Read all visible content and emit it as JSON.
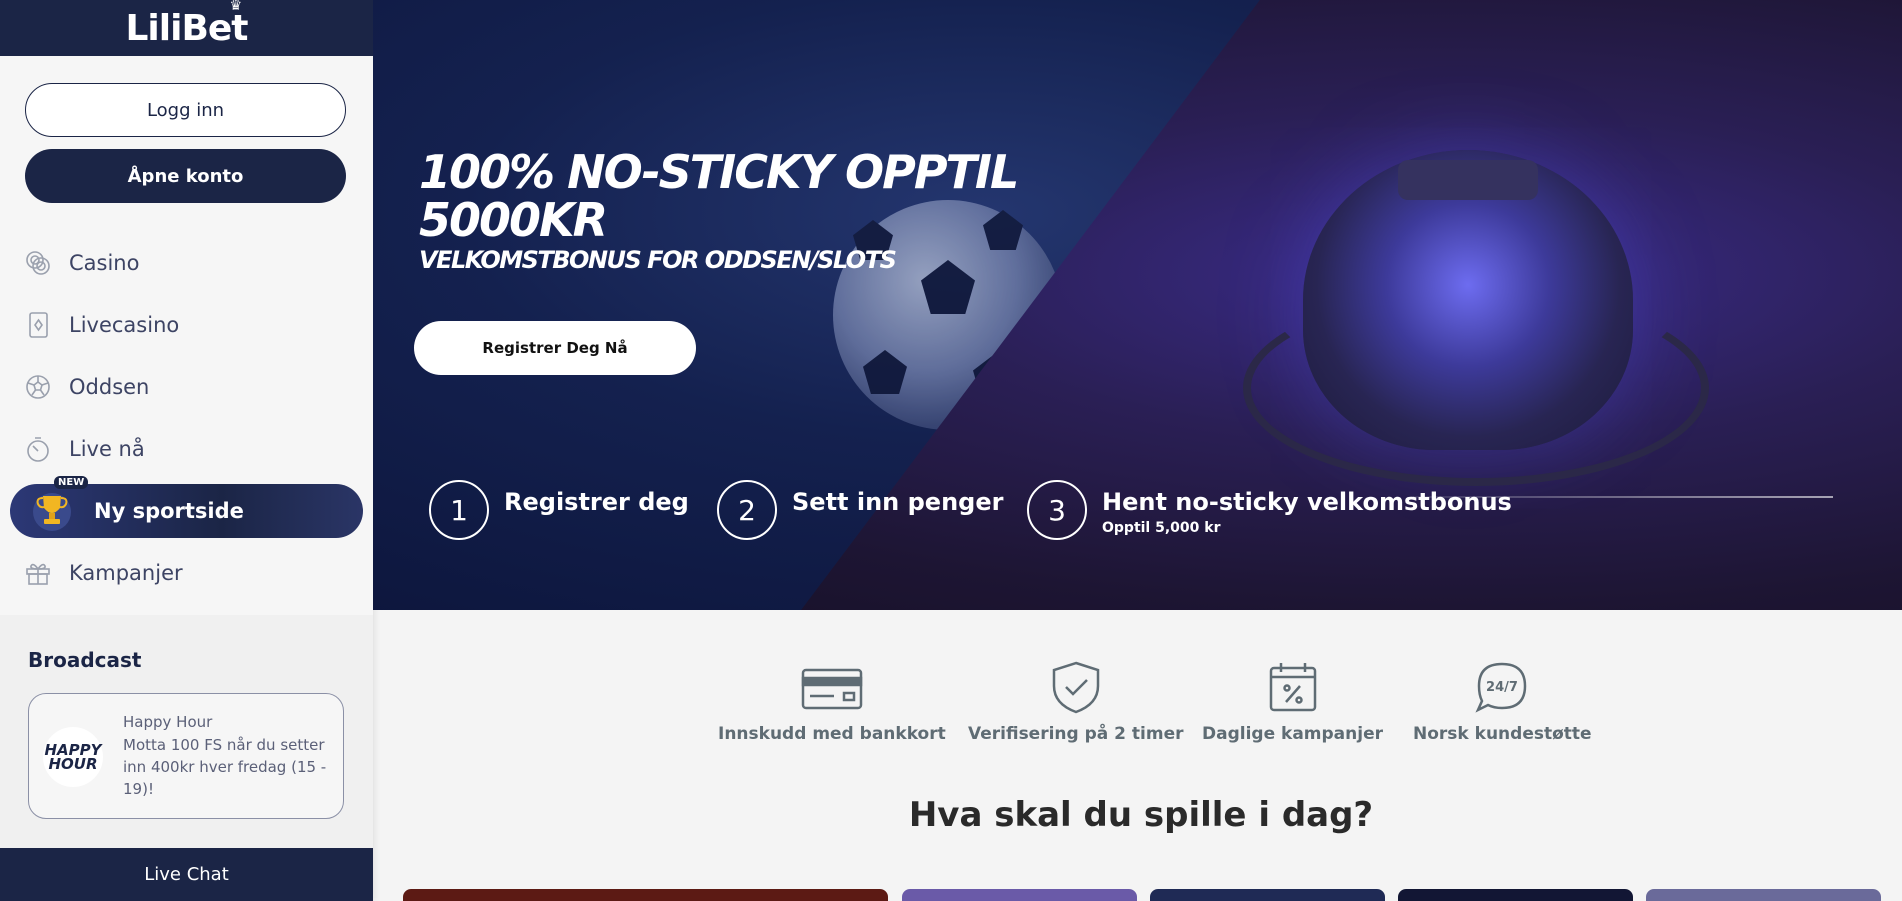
{
  "sidebar": {
    "logo": "LiliBet",
    "login_button": "Logg inn",
    "open_account_button": "Åpne konto",
    "nav": [
      {
        "label": "Casino",
        "icon": "chips-icon"
      },
      {
        "label": "Livecasino",
        "icon": "card-icon"
      },
      {
        "label": "Oddsen",
        "icon": "football-icon"
      },
      {
        "label": "Live nå",
        "icon": "stopwatch-icon"
      }
    ],
    "new_item": {
      "label": "Ny sportside",
      "badge": "NEW",
      "icon": "trophy-icon"
    },
    "campaigns": {
      "label": "Kampanjer",
      "icon": "gift-icon"
    },
    "broadcast": {
      "title": "Broadcast",
      "card_logo": "HAPPY HOUR",
      "card_title": "Happy Hour",
      "card_text": "Motta 100 FS når du setter inn 400kr hver fredag (15 - 19)!"
    },
    "live_chat": "Live Chat"
  },
  "hero": {
    "title": "100% NO-STICKY OPPTIL 5000KR",
    "subtitle": "VELKOMSTBONUS FOR ODDSEN/SLOTS",
    "cta": "Registrer Deg Nå",
    "steps": [
      {
        "num": "1",
        "label": "Registrer deg",
        "sub": ""
      },
      {
        "num": "2",
        "label": "Sett inn penger",
        "sub": ""
      },
      {
        "num": "3",
        "label": "Hent no-sticky velkomstbonus",
        "sub": "Opptil 5,000 kr"
      }
    ]
  },
  "features": [
    {
      "label": "Innskudd med bankkort",
      "icon": "credit-card-icon"
    },
    {
      "label": "Verifisering på 2 timer",
      "icon": "shield-check-icon"
    },
    {
      "label": "Daglige kampanjer",
      "icon": "calendar-percent-icon"
    },
    {
      "label": "Norsk kundestøtte",
      "icon": "chat-24-7-icon"
    }
  ],
  "section_title": "Hva skal du spille i dag?",
  "colors": {
    "navy": "#1b2546",
    "feature_gray": "#5f6c74",
    "bg": "#f4f4f4"
  }
}
